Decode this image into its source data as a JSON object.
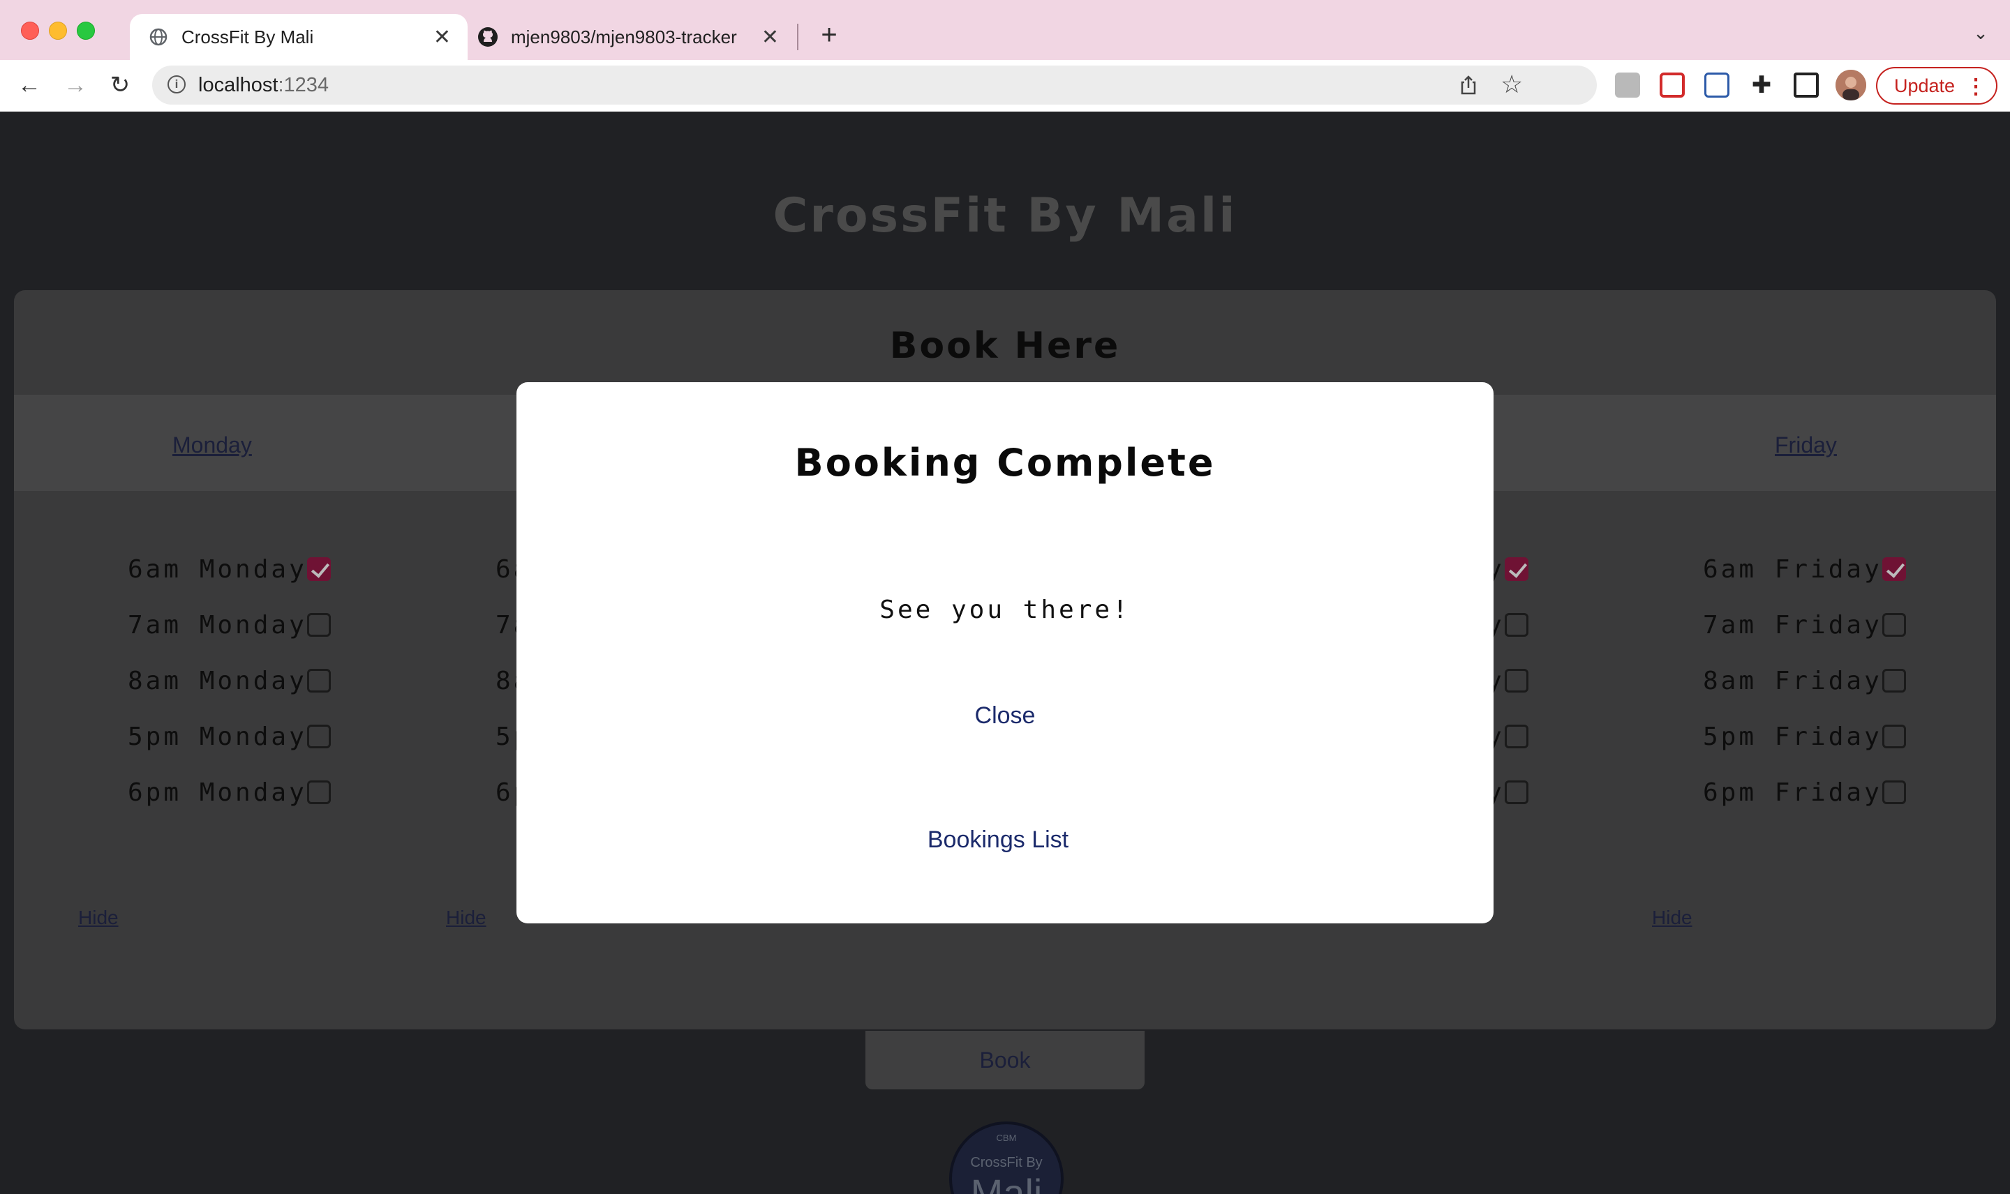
{
  "browser": {
    "tabs": [
      {
        "title": "CrossFit By Mali",
        "active": true,
        "icon": "globe-icon"
      },
      {
        "title": "mjen9803/mjen9803-tracker",
        "active": false,
        "icon": "github-icon"
      }
    ],
    "address": {
      "host": "localhost",
      "port": ":1234"
    },
    "update_label": "Update",
    "colors": {
      "tabbar": "#f1d6e3",
      "update": "#c5221f"
    }
  },
  "site": {
    "title": "CrossFit By Mali",
    "booking_heading": "Book Here",
    "days": [
      "Monday",
      "Friday"
    ],
    "columns": [
      {
        "slots": [
          {
            "label": "6am Monday",
            "checked": true
          },
          {
            "label": "7am Monday",
            "checked": false
          },
          {
            "label": "8am Monday",
            "checked": false
          },
          {
            "label": "5pm Monday",
            "checked": false
          },
          {
            "label": "6pm Monday",
            "checked": false
          }
        ]
      },
      {
        "slots": [
          {
            "label": "6a",
            "checked": false
          },
          {
            "label": "7a",
            "checked": false
          },
          {
            "label": "8a",
            "checked": false
          },
          {
            "label": "5p",
            "checked": false
          },
          {
            "label": "6p",
            "checked": false
          }
        ]
      },
      {
        "slots": [
          {
            "label": "y",
            "checked": true
          },
          {
            "label": "y",
            "checked": false
          },
          {
            "label": "y",
            "checked": false
          },
          {
            "label": "y",
            "checked": false
          },
          {
            "label": "y",
            "checked": false
          }
        ]
      },
      {
        "slots": [
          {
            "label": "6am Friday",
            "checked": true
          },
          {
            "label": "7am Friday",
            "checked": false
          },
          {
            "label": "8am Friday",
            "checked": false
          },
          {
            "label": "5pm Friday",
            "checked": false
          },
          {
            "label": "6pm Friday",
            "checked": false
          }
        ]
      }
    ],
    "hide_label": "Hide",
    "book_label": "Book",
    "logo": {
      "top": "CBM",
      "middle": "CrossFit By",
      "bottom": "Mali"
    },
    "colors": {
      "checked": "#6f1234",
      "link": "#1b2a6b"
    }
  },
  "modal": {
    "title": "Booking Complete",
    "message": "See you there!",
    "close_label": "Close",
    "list_label": "Bookings List"
  }
}
